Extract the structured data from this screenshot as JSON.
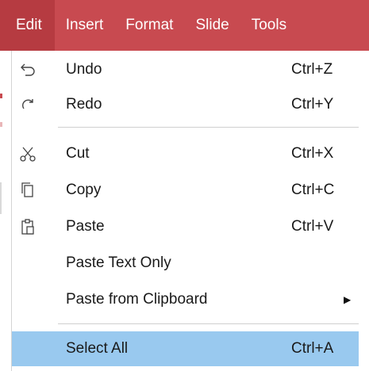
{
  "menubar": {
    "items": [
      "Edit",
      "Insert",
      "Format",
      "Slide",
      "Tools"
    ]
  },
  "menu": {
    "items": [
      {
        "label": "Undo",
        "shortcut": "Ctrl+Z",
        "icon": "undo-icon"
      },
      {
        "label": "Redo",
        "shortcut": "Ctrl+Y",
        "icon": "redo-icon"
      },
      {
        "label": "Cut",
        "shortcut": "Ctrl+X",
        "icon": "scissors-icon"
      },
      {
        "label": "Copy",
        "shortcut": "Ctrl+C",
        "icon": "copy-icon"
      },
      {
        "label": "Paste",
        "shortcut": "Ctrl+V",
        "icon": "paste-icon"
      },
      {
        "label": "Paste Text Only",
        "shortcut": "",
        "icon": ""
      },
      {
        "label": "Paste from Clipboard",
        "shortcut": "",
        "icon": "submenu-arrow-icon"
      },
      {
        "label": "Select All",
        "shortcut": "Ctrl+A",
        "icon": ""
      }
    ]
  },
  "colors": {
    "menubar_bg": "#c84a50",
    "menubar_active_bg": "#b63b41",
    "highlight": "#99c9ef"
  }
}
